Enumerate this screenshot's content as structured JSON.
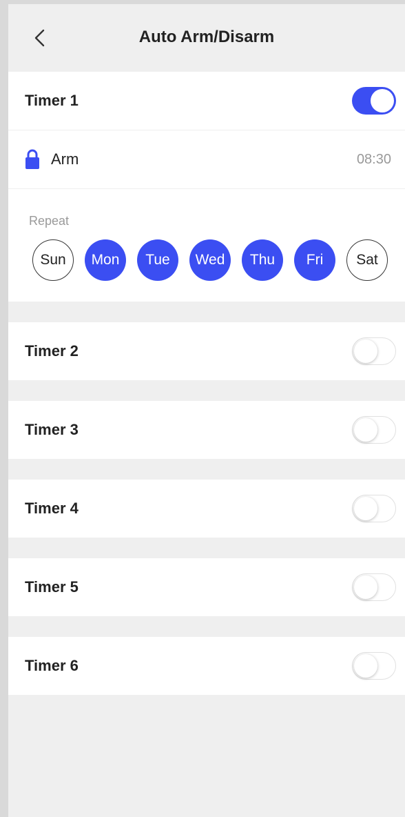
{
  "header": {
    "title": "Auto Arm/Disarm"
  },
  "timer1": {
    "label": "Timer 1",
    "enabled": true,
    "mode_label": "Arm",
    "time": "08:30",
    "repeat_label": "Repeat",
    "days": [
      {
        "label": "Sun",
        "selected": false
      },
      {
        "label": "Mon",
        "selected": true
      },
      {
        "label": "Tue",
        "selected": true
      },
      {
        "label": "Wed",
        "selected": true
      },
      {
        "label": "Thu",
        "selected": true
      },
      {
        "label": "Fri",
        "selected": true
      },
      {
        "label": "Sat",
        "selected": false
      }
    ]
  },
  "timers": [
    {
      "label": "Timer 2",
      "enabled": false
    },
    {
      "label": "Timer 3",
      "enabled": false
    },
    {
      "label": "Timer 4",
      "enabled": false
    },
    {
      "label": "Timer 5",
      "enabled": false
    },
    {
      "label": "Timer 6",
      "enabled": false
    }
  ],
  "colors": {
    "accent": "#3b4ef2",
    "background": "#efefef",
    "card": "#ffffff"
  },
  "icons": {
    "back": "chevron-left-icon",
    "lock": "lock-icon"
  }
}
